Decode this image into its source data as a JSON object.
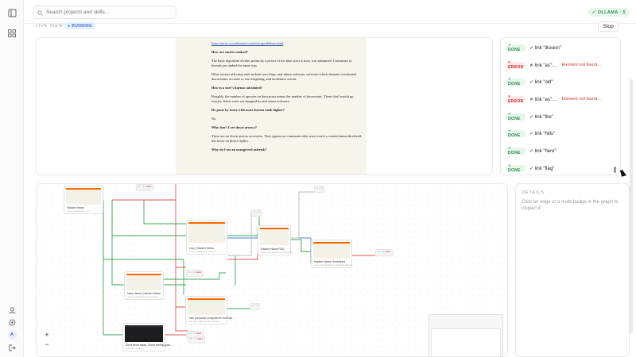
{
  "search": {
    "placeholder": "Search projects and skills..."
  },
  "status": {
    "ollama": "✓ OLLAMA · 5"
  },
  "live": {
    "label": "LIVE VIEW",
    "state": "● RUNNING",
    "stop": "Stop"
  },
  "page": {
    "link": "https://news.ycombinator.com/newsguidelines.html",
    "paragraphs": [
      {
        "kind": "q",
        "text": "How are stories ranked?"
      },
      {
        "kind": "p",
        "text": "The basic algorithm divides points by a power of the time since a story was submitted. Comments in threads are ranked the same way."
      },
      {
        "kind": "p",
        "text": "Other factors affecting rank include user flags, anti-abuse software, software which demotes overheated discussions, account or site weighting, and moderator action."
      },
      {
        "kind": "q",
        "text": "How is a user's karma calculated?"
      },
      {
        "kind": "p",
        "text": "Roughly, the number of upvotes on their posts minus the number of downvotes. These don't match up exactly. Some votes are dropped by anti-abuse software."
      },
      {
        "kind": "q",
        "text": "Do posts by users with more karma rank higher?"
      },
      {
        "kind": "p",
        "text": "No."
      },
      {
        "kind": "q",
        "text": "Why don't I see down arrows?"
      },
      {
        "kind": "p",
        "text": "There are no down arrows on stories. They appear on comments after users reach a certain karma threshold, but never on direct replies."
      },
      {
        "kind": "q",
        "text": "Why do I see an orange/red asterisk?"
      }
    ]
  },
  "steps": [
    {
      "status": "DONE",
      "mark": "✓",
      "text": "link \"illusion\"",
      "error": ""
    },
    {
      "status": "ERROR",
      "mark": "✕",
      "text": "link \"as\":...",
      "error": "Element not found..."
    },
    {
      "status": "DONE",
      "mark": "✓",
      "text": "link \"old\"",
      "error": ""
    },
    {
      "status": "ERROR",
      "mark": "✕",
      "text": "link \"as\":...",
      "error": "Element not found..."
    },
    {
      "status": "DONE",
      "mark": "✓",
      "text": "link \"the\"",
      "error": ""
    },
    {
      "status": "DONE",
      "mark": "✓",
      "text": "link \"hills\"",
      "error": ""
    },
    {
      "status": "DONE",
      "mark": "✓",
      "text": "link \"here\"",
      "error": ""
    },
    {
      "status": "DONE",
      "mark": "✓",
      "text": "link \"flag\"",
      "error": ""
    }
  ],
  "details": {
    "title": "DETAILS",
    "hint": "Click an edge or a node badge in the graph to inspect it."
  },
  "graph": {
    "nodes": [
      {
        "cap": "Hacker News",
        "sub": "news.ycombinator.com",
        "dark": false
      },
      {
        "cap": "Lisp | Hacker News",
        "sub": "news.ycombinator.com/item",
        "dark": false
      },
      {
        "cap": "Hacker News FAQ",
        "sub": "news.ycombinator.com/newsfaq",
        "dark": false
      },
      {
        "cap": "Hacker News Guidelines",
        "sub": "news.ycombinator.com/newsguidelines",
        "dark": false
      },
      {
        "cap": "New Users | Hacker News",
        "sub": "news.ycombinator.com/newest",
        "dark": false
      },
      {
        "cap": "Your personal computer is not that ...",
        "sub": "example.org/personal-computer",
        "dark": false
      },
      {
        "cap": "Don't blow away. Close feeling your ...",
        "sub": "example.com/blog",
        "dark": true
      }
    ],
    "chips": [
      {
        "a": "0 → 0",
        "b": "failed"
      },
      {
        "a": "0 → 0",
        "b": ""
      },
      {
        "a": "0 → 0",
        "b": ""
      },
      {
        "a": "0 → 0",
        "b": "failed"
      },
      {
        "a": "0 → 0",
        "b": "failed"
      },
      {
        "a": "0 → 0",
        "b": ""
      },
      {
        "a": "0 → 0",
        "b": "failed"
      },
      {
        "a": "0 → 0",
        "b": "failed"
      }
    ]
  },
  "zoom": {
    "in": "+",
    "out": "−"
  },
  "colors": {
    "done": "#2e8b4f",
    "error": "#c93535",
    "edge_green": "#3aa655",
    "edge_red": "#e05252",
    "edge_blue": "#4a7fd6",
    "edge_gray": "#bbbbbb"
  }
}
